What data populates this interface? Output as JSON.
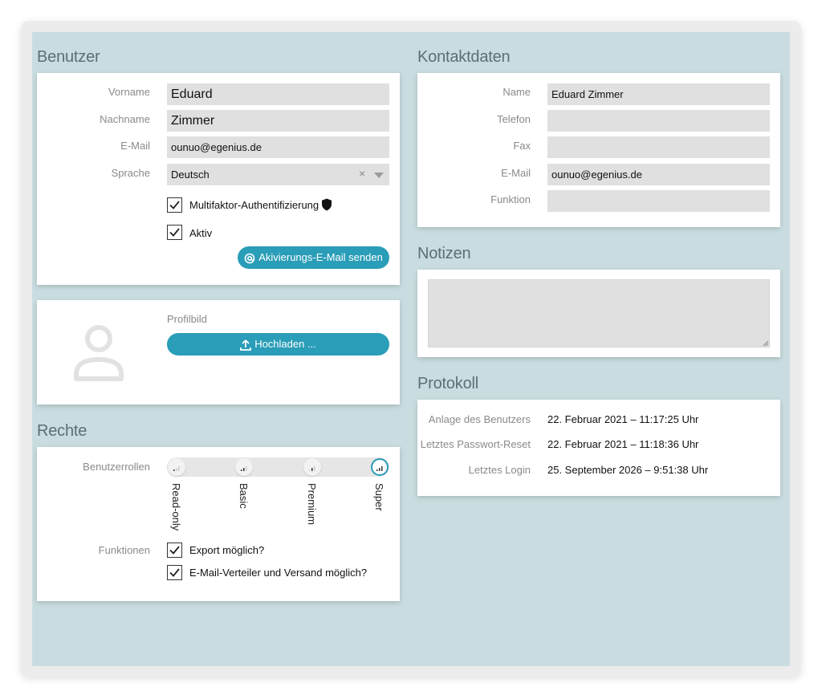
{
  "sections": {
    "benutzer": "Benutzer",
    "kontaktdaten": "Kontaktdaten",
    "notizen": "Notizen",
    "protokoll": "Protokoll",
    "rechte": "Rechte"
  },
  "benutzer": {
    "vorname_label": "Vorname",
    "vorname_value": "Eduard",
    "nachname_label": "Nachname",
    "nachname_value": "Zimmer",
    "email_label": "E-Mail",
    "email_value": "ounuo@egenius.de",
    "sprache_label": "Sprache",
    "sprache_value": "Deutsch",
    "sprache_clear": "×",
    "mfa_label": "Multifaktor-Authentifizierung",
    "mfa_checked": true,
    "aktiv_label": "Aktiv",
    "aktiv_checked": true,
    "activation_button": "Akivierungs-E-Mail senden"
  },
  "profilbild": {
    "label": "Profilbild",
    "upload_button": "Hochladen ..."
  },
  "rechte": {
    "rollen_label": "Benutzerrollen",
    "rollen": [
      "Read-only",
      "Basic",
      "Premium",
      "Super"
    ],
    "selected_role": "Super",
    "funktionen_label": "Funktionen",
    "export_label": "Export möglich?",
    "export_checked": true,
    "verteiler_label": "E-Mail-Verteiler und Versand möglich?",
    "verteiler_checked": true
  },
  "kontakt": {
    "name_label": "Name",
    "name_value": "Eduard Zimmer",
    "telefon_label": "Telefon",
    "telefon_value": "",
    "fax_label": "Fax",
    "fax_value": "",
    "email_label": "E-Mail",
    "email_value": "ounuo@egenius.de",
    "funktion_label": "Funktion",
    "funktion_value": ""
  },
  "notizen": {
    "value": ""
  },
  "protokoll": {
    "anlage_label": "Anlage des Benutzers",
    "anlage_value": "22. Februar 2021 – 11:17:25 Uhr",
    "reset_label": "Letztes Passwort-Reset",
    "reset_value": "22. Februar 2021 – 11:18:36 Uhr",
    "login_label": "Letztes Login",
    "login_value": "25. September 2026 – 9:51:38 Uhr"
  },
  "colors": {
    "accent": "#2a9db8",
    "background": "#c9dde0",
    "field": "#e0e0e0"
  }
}
